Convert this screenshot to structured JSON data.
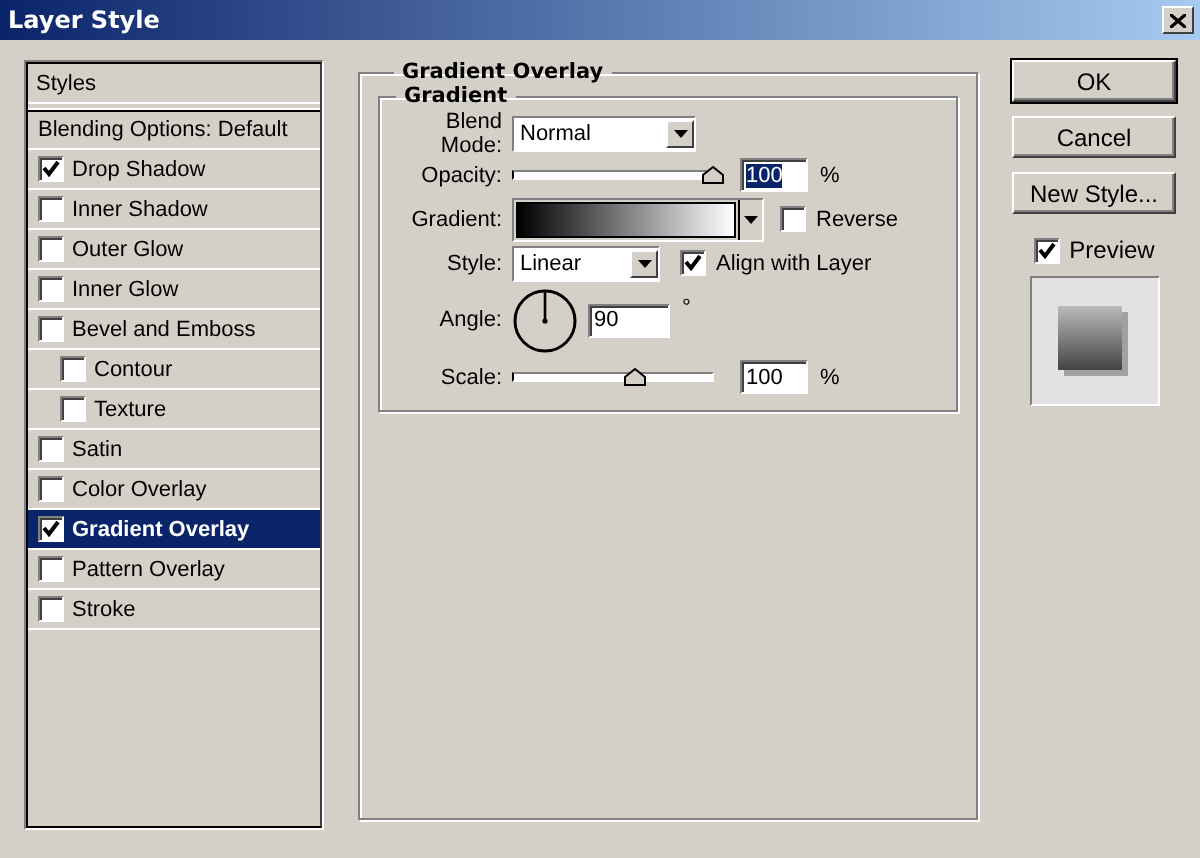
{
  "window": {
    "title": "Layer Style"
  },
  "styles_list": {
    "header": "Styles",
    "items": [
      {
        "label": "Blending Options: Default",
        "kind": "plain",
        "selected": false
      },
      {
        "label": "Drop Shadow",
        "kind": "checkbox",
        "checked": true,
        "selected": false
      },
      {
        "label": "Inner Shadow",
        "kind": "checkbox",
        "checked": false,
        "selected": false
      },
      {
        "label": "Outer Glow",
        "kind": "checkbox",
        "checked": false,
        "selected": false
      },
      {
        "label": "Inner Glow",
        "kind": "checkbox",
        "checked": false,
        "selected": false
      },
      {
        "label": "Bevel and Emboss",
        "kind": "checkbox",
        "checked": false,
        "selected": false,
        "children": [
          {
            "label": "Contour",
            "kind": "checkbox",
            "checked": false,
            "selected": false
          },
          {
            "label": "Texture",
            "kind": "checkbox",
            "checked": false,
            "selected": false
          }
        ]
      },
      {
        "label": "Satin",
        "kind": "checkbox",
        "checked": false,
        "selected": false
      },
      {
        "label": "Color Overlay",
        "kind": "checkbox",
        "checked": false,
        "selected": false
      },
      {
        "label": "Gradient Overlay",
        "kind": "checkbox",
        "checked": true,
        "selected": true
      },
      {
        "label": "Pattern Overlay",
        "kind": "checkbox",
        "checked": false,
        "selected": false
      },
      {
        "label": "Stroke",
        "kind": "checkbox",
        "checked": false,
        "selected": false
      }
    ]
  },
  "panel": {
    "title": "Gradient Overlay",
    "group": {
      "title": "Gradient",
      "blend_mode": {
        "label": "Blend Mode:",
        "value": "Normal"
      },
      "opacity": {
        "label": "Opacity:",
        "level": 1,
        "value": "100",
        "value_selected": true,
        "unit": "%"
      },
      "gradient": {
        "label": "Gradient:",
        "reverse": {
          "label": "Reverse",
          "checked": false
        }
      },
      "style": {
        "label": "Style:",
        "value": "Linear",
        "align": {
          "label": "Align with Layer",
          "checked": true
        }
      },
      "angle": {
        "label": "Angle:",
        "value": "90",
        "unit": "°"
      },
      "scale": {
        "label": "Scale:",
        "level": 0.61,
        "value": "100",
        "value_selected": false,
        "unit": "%"
      }
    }
  },
  "buttons": [
    {
      "label": "OK",
      "default": true
    },
    {
      "label": "Cancel",
      "default": false
    },
    {
      "label": "New Style...",
      "default": false
    }
  ],
  "preview": {
    "label": "Preview",
    "checked": true
  }
}
